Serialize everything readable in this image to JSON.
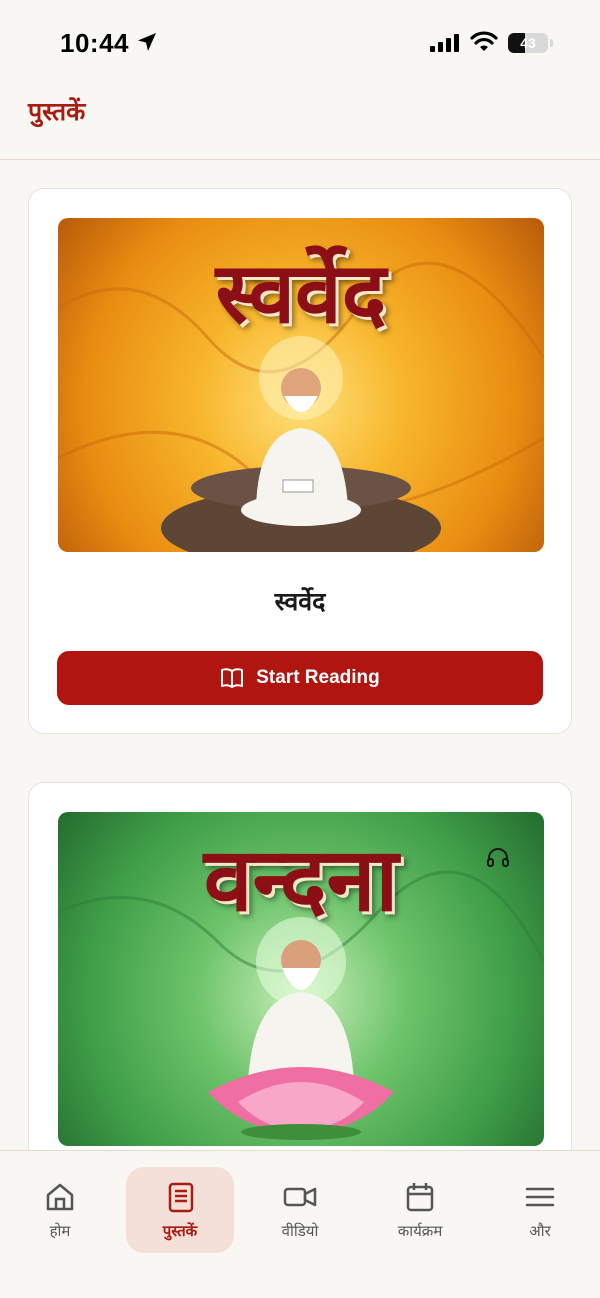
{
  "status_bar": {
    "time": "10:44",
    "battery": "43"
  },
  "header": {
    "title": "पुस्तकें"
  },
  "books": [
    {
      "cover_title": "स्वर्वेद",
      "name": "स्वर्वेद",
      "button_label": "Start Reading",
      "button_icon": "book-open-icon"
    },
    {
      "cover_title": "वन्दना",
      "has_audio": true,
      "audio_icon": "headphones-icon"
    }
  ],
  "nav": {
    "items": [
      {
        "label": "होम",
        "icon": "home-icon"
      },
      {
        "label": "पुस्तकें",
        "icon": "book-icon",
        "active": true
      },
      {
        "label": "वीडियो",
        "icon": "video-icon"
      },
      {
        "label": "कार्यक्रम",
        "icon": "calendar-icon"
      },
      {
        "label": "और",
        "icon": "menu-icon"
      }
    ]
  },
  "colors": {
    "accent": "#b0160f",
    "title": "#a81d12",
    "background": "#f8f7f4"
  }
}
